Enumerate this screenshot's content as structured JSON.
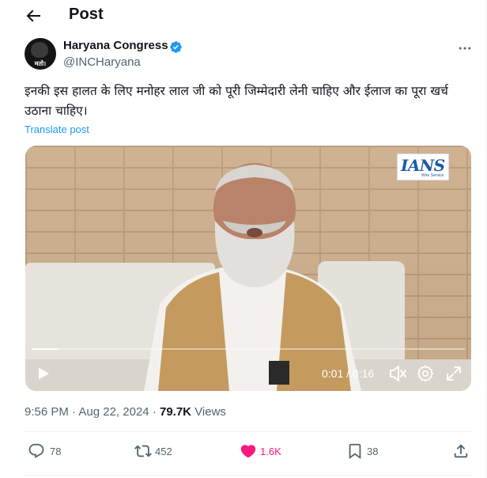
{
  "header": {
    "title": "Post"
  },
  "author": {
    "name": "Haryana Congress",
    "handle": "@INCHaryana",
    "avatar_text": "मतो।"
  },
  "tweet": {
    "text": "इनकी इस हालत के लिए मनोहर लाल जी को पूरी जिम्मेदारी लेनी चाहिए और ईलाज का पूरा खर्च उठाना चाहिए।",
    "translate_label": "Translate post"
  },
  "video": {
    "watermark": "IANS",
    "watermark_sub": "Wire Service",
    "time_display": "0:01 / 0:16",
    "progress": 0.0625
  },
  "meta": {
    "time": "9:56 PM",
    "date": "Aug 22, 2024",
    "views_count": "79.7K",
    "views_label": "Views",
    "separator": "·"
  },
  "actions": {
    "replies": "78",
    "reposts": "452",
    "likes": "1.6K",
    "bookmarks": "38"
  },
  "colors": {
    "accent": "#1d9bf0",
    "like": "#f91880",
    "muted": "#536471"
  }
}
